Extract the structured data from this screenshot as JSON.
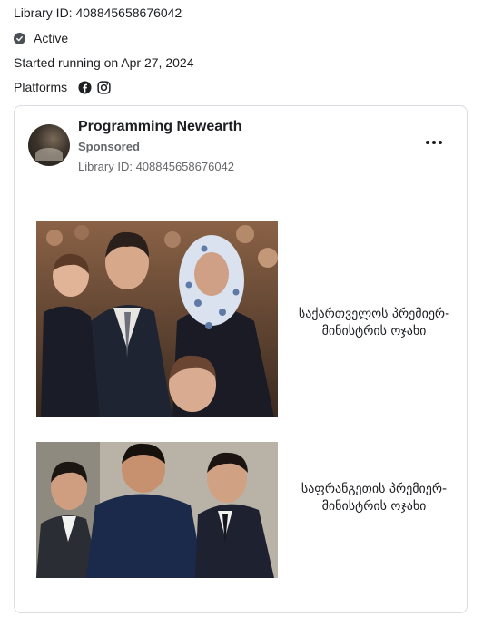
{
  "header": {
    "library_id": "Library ID: 408845658676042",
    "status": "Active",
    "started": "Started running on Apr 27, 2024",
    "platforms_label": "Platforms",
    "platform_icons": [
      "facebook-icon",
      "instagram-icon"
    ]
  },
  "ad": {
    "page_name": "Programming Newearth",
    "sponsored_label": "Sponsored",
    "library_id": "Library ID: 408845658676042",
    "more_icon": "more-options-icon",
    "items": [
      {
        "caption": "საქართველოს პრემიერ-მინისტრის ოჯახი"
      },
      {
        "caption": "საფრანგეთის პრემიერ-მინისტრის ოჯახი"
      }
    ]
  },
  "colors": {
    "text": "#1c1e21",
    "secondary_text": "#65676b",
    "border": "#dadde1"
  }
}
